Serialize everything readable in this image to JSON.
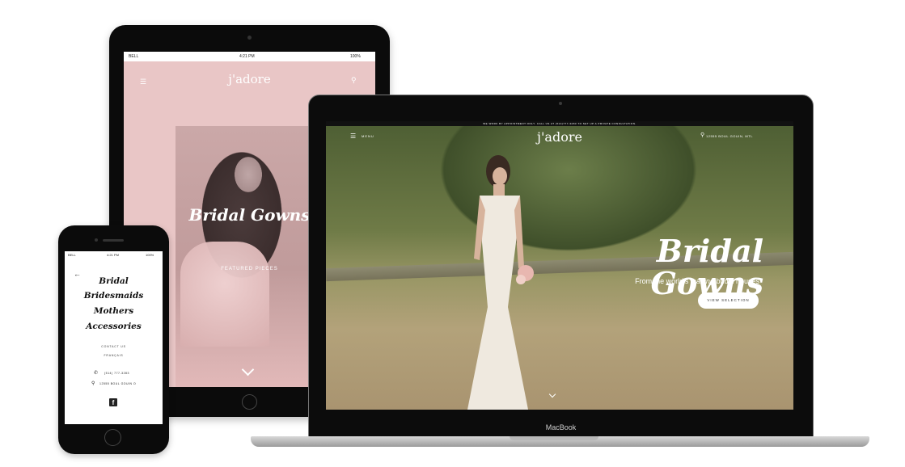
{
  "ipad": {
    "status": {
      "carrier": "BELL",
      "time": "4:21 PM",
      "battery": "100%"
    },
    "logo": "j'adore",
    "title": "Bridal Gowns",
    "featured": "FEATURED PIECES",
    "menu_icon": "hamburger-icon",
    "pin_icon": "map-pin-icon"
  },
  "macbook": {
    "top_strip": "WE WORK BY APPOINTMENT ONLY. CALL US AT (514)777-3283 TO SET UP A PRIVATE CONSULTATION.",
    "menu_label": "MENU",
    "logo": "j'adore",
    "address": "12555 BOUL GOUIN, MTL",
    "hero_title": "Bridal Gowns",
    "hero_sub_before": "From the world's ",
    "hero_sub_em": "leading",
    "hero_sub_after": " bridal houses",
    "cta": "VIEW SELECTION",
    "device_label": "MacBook"
  },
  "phone": {
    "status": {
      "carrier": "BELL",
      "time": "4:21 PM",
      "battery": "100%"
    },
    "nav": [
      "Bridal",
      "Bridesmaids",
      "Mothers",
      "Accessories"
    ],
    "contact": "CONTACT US",
    "language": "FRANÇAIS",
    "phone_number": "(514) 777-3283",
    "address": "12555 BOUL GOUIN O",
    "social_icon": "facebook-icon"
  },
  "colors": {
    "ipad_bg": "#e9c6c6",
    "accent_white": "#ffffff",
    "frame": "#0b0b0b"
  }
}
